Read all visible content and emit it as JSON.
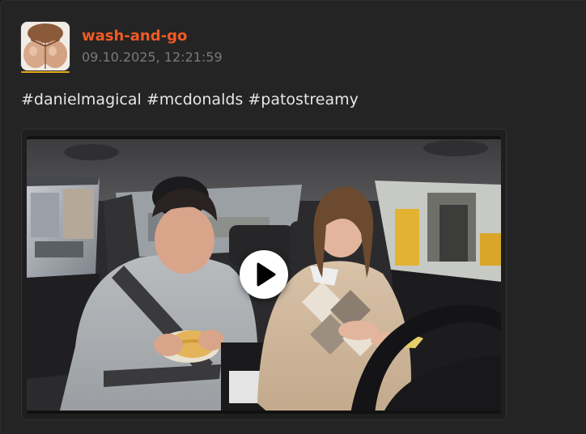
{
  "post": {
    "author": "wash-and-go",
    "timestamp": "09.10.2025, 12:21:59",
    "hashtags": [
      "#danielmagical",
      "#mcdonalds",
      "#patostreamy"
    ],
    "avatar_icon": "avatar-image",
    "media": {
      "type": "video",
      "play_icon": "play-icon"
    }
  },
  "colors": {
    "author": "#f15a24",
    "timestamp": "#7a7a7a",
    "text": "#e6e6e6",
    "background": "#242424"
  }
}
